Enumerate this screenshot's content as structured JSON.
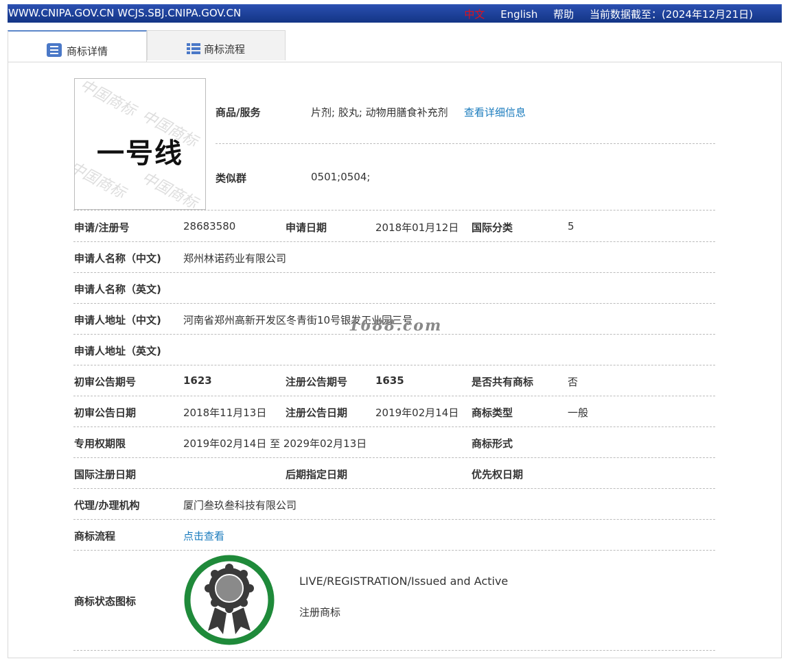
{
  "topbar": {
    "site": "WWW.CNIPA.GOV.CN  WCJS.SBJ.CNIPA.GOV.CN",
    "lang_zh": "中文",
    "lang_en": "English",
    "help": "帮助",
    "data_date": "当前数据截至：(2024年12月21日)"
  },
  "tabs": [
    {
      "label": "商标详情",
      "icon": "list-icon",
      "active": true
    },
    {
      "label": "商标流程",
      "icon": "grid-list-icon",
      "active": false
    }
  ],
  "trademark_image": {
    "text": "一号线",
    "watermark": "中国商标"
  },
  "goods": {
    "label": "商品/服务",
    "value": "片剂; 胶丸; 动物用膳食补充剂",
    "link": "查看详细信息"
  },
  "similar_group": {
    "label": "类似群",
    "value": "0501;0504;"
  },
  "rows": {
    "reg_no_label": "申请/注册号",
    "reg_no": "28683580",
    "apply_date_label": "申请日期",
    "apply_date": "2018年01月12日",
    "intl_class_label": "国际分类",
    "intl_class": "5",
    "applicant_cn_label": "申请人名称（中文)",
    "applicant_cn": "郑州林诺药业有限公司",
    "applicant_en_label": "申请人名称（英文)",
    "applicant_en": "",
    "address_cn_label": "申请人地址（中文)",
    "address_cn": "河南省郑州高新开发区冬青街10号银发工业园三号",
    "address_en_label": "申请人地址（英文)",
    "address_en": "",
    "prelim_issue_label": "初审公告期号",
    "prelim_issue": "1623",
    "reg_issue_label": "注册公告期号",
    "reg_issue": "1635",
    "shared_label": "是否共有商标",
    "shared": "否",
    "prelim_date_label": "初审公告日期",
    "prelim_date": "2018年11月13日",
    "reg_date_label": "注册公告日期",
    "reg_date": "2019年02月14日",
    "tm_type_label": "商标类型",
    "tm_type": "一般",
    "term_label": "专用权期限",
    "term": "2019年02月14日 至 2029年02月13日",
    "tm_form_label": "商标形式",
    "tm_form": "",
    "intl_reg_date_label": "国际注册日期",
    "later_date_label": "后期指定日期",
    "priority_date_label": "优先权日期",
    "agency_label": "代理/办理机构",
    "agency": "厦门叁玖叁科技有限公司",
    "flow_label": "商标流程",
    "flow_link": "点击查看",
    "status_label": "商标状态图标",
    "status_en": "LIVE/REGISTRATION/Issued and Active",
    "status_cn": "注册商标"
  },
  "overlay_watermark": "1688.com",
  "background_watermark": [
    "中",
    "国",
    "商",
    "标"
  ],
  "colors": {
    "topbar": "#1a3f9a",
    "link": "#1a7bbd",
    "badge_ring": "#1f8a3a",
    "lang_active": "#e0101a"
  }
}
